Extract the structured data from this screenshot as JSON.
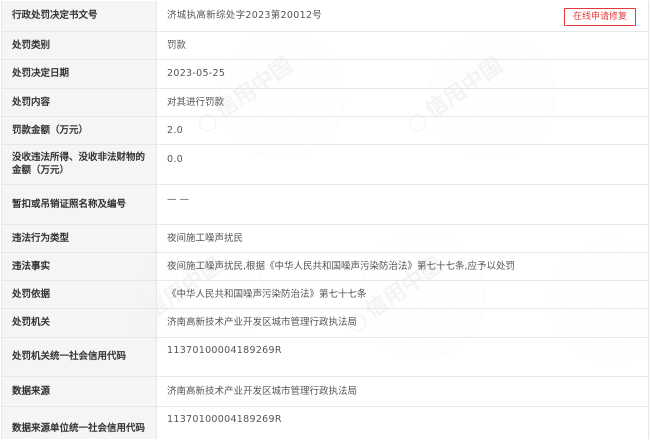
{
  "record": {
    "rows": [
      {
        "label": "行政处罚决定书文号",
        "value": "济城执高新综处字2023第20012号"
      },
      {
        "label": "处罚类别",
        "value": "罚款"
      },
      {
        "label": "处罚决定日期",
        "value": "2023-05-25"
      },
      {
        "label": "处罚内容",
        "value": "对其进行罚款"
      },
      {
        "label": "罚款金额（万元）",
        "value": "2.0"
      },
      {
        "label": "没收违法所得、没收非法财物的金额（万元）",
        "value": "0.0"
      },
      {
        "label": "暂扣或吊销证照名称及编号",
        "value": "— —"
      },
      {
        "label": "违法行为类型",
        "value": "夜间施工噪声扰民"
      },
      {
        "label": "违法事实",
        "value": "夜间施工噪声扰民,根据《中华人民共和国噪声污染防治法》第七十七条,应予以处罚"
      },
      {
        "label": "处罚依据",
        "value": "《中华人民共和国噪声污染防治法》第七十七条"
      },
      {
        "label": "处罚机关",
        "value": "济南高新技术产业开发区城市管理行政执法局"
      },
      {
        "label": "处罚机关统一社会信用代码",
        "value": "11370100004189269R"
      },
      {
        "label": "数据来源",
        "value": "济南高新技术产业开发区城市管理行政执法局"
      },
      {
        "label": "数据来源单位统一社会信用代码",
        "value": "11370100004189269R"
      }
    ],
    "repair_button": "在线申请修复"
  },
  "watermark": {
    "text": "信用中国",
    "color": "#9aa89a"
  },
  "colors": {
    "accent": "#e33b3b",
    "label_bg": "#f4f4f4",
    "border": "#e7e7e7"
  }
}
